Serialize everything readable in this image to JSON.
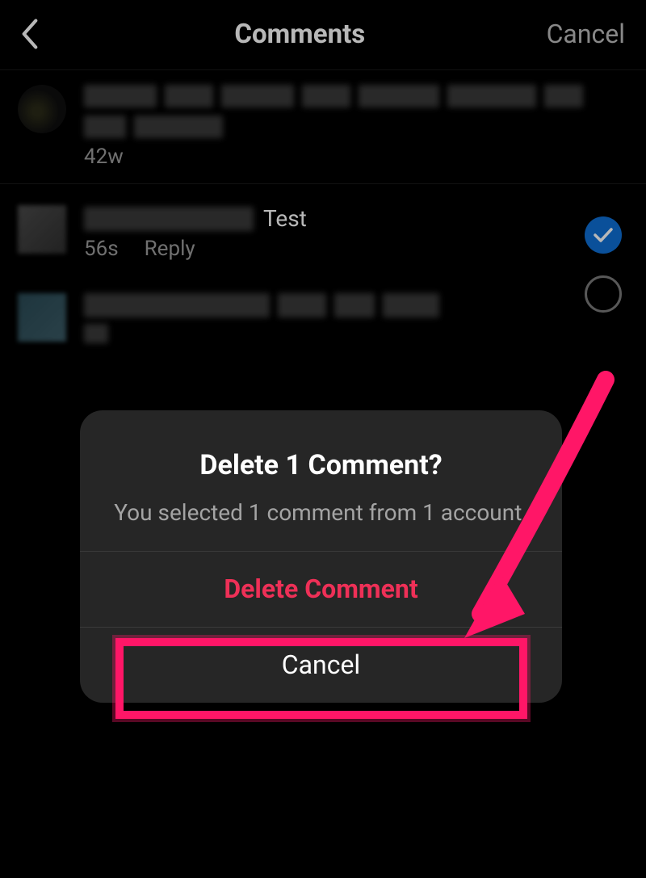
{
  "header": {
    "title": "Comments",
    "cancel_label": "Cancel"
  },
  "caption": {
    "timestamp": "42w"
  },
  "comment1": {
    "text": "Test",
    "timestamp": "56s",
    "reply_label": "Reply"
  },
  "modal": {
    "title": "Delete 1 Comment?",
    "subtitle": "You selected 1 comment from 1 account.",
    "delete_label": "Delete Comment",
    "cancel_label": "Cancel"
  },
  "colors": {
    "accent_pink": "#ff1667",
    "check_blue": "#0e6fd6",
    "danger_text": "#ee3057"
  }
}
